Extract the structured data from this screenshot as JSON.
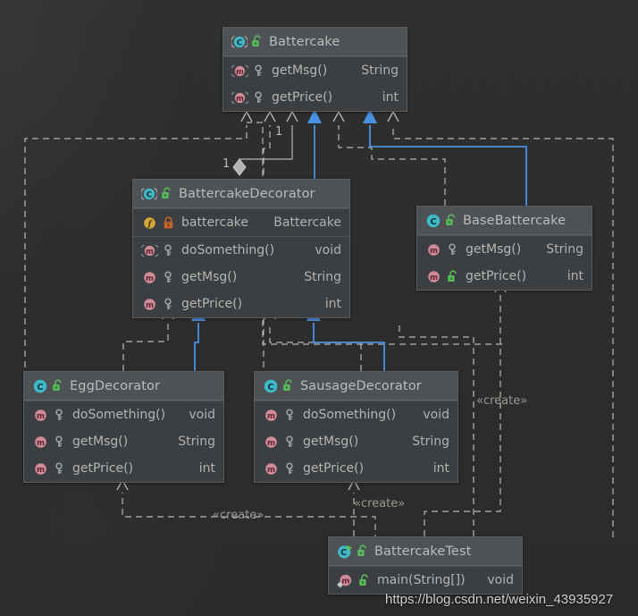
{
  "diagram": {
    "title": "Battercake decorator UML class diagram",
    "background_color": "#2e2e2e",
    "box_fill": "#3c3f41",
    "header_fill": "#4e5254",
    "inherit_arrow_color": "#4a90e2",
    "dashed_line_color": "#b0b0b0"
  },
  "classes": {
    "battercake": {
      "name": "Battercake",
      "class_icon": "interface-icon",
      "visibility_icon": "public-unlock-icon",
      "members": [
        {
          "label": "getMsg()",
          "type": "String",
          "member_icon": "abstract-method-icon",
          "visibility_icon": "key-icon"
        },
        {
          "label": "getPrice()",
          "type": "int",
          "member_icon": "abstract-method-icon",
          "visibility_icon": "key-icon"
        }
      ]
    },
    "battercake_decorator": {
      "name": "BattercakeDecorator",
      "class_icon": "abstract-class-icon",
      "visibility_icon": "public-unlock-icon",
      "fields": [
        {
          "label": "battercake",
          "type": "Battercake",
          "member_icon": "field-icon",
          "visibility_icon": "private-lock-icon"
        }
      ],
      "members": [
        {
          "label": "doSomething()",
          "type": "void",
          "member_icon": "abstract-method-icon",
          "visibility_icon": "key-icon"
        },
        {
          "label": "getMsg()",
          "type": "String",
          "member_icon": "method-icon",
          "visibility_icon": "key-icon"
        },
        {
          "label": "getPrice()",
          "type": "int",
          "member_icon": "method-icon",
          "visibility_icon": "key-icon"
        }
      ]
    },
    "base_battercake": {
      "name": "BaseBattercake",
      "class_icon": "class-icon",
      "visibility_icon": "public-unlock-icon",
      "members": [
        {
          "label": "getMsg()",
          "type": "String",
          "member_icon": "method-icon",
          "visibility_icon": "key-icon"
        },
        {
          "label": "getPrice()",
          "type": "int",
          "member_icon": "method-icon",
          "visibility_icon": "public-unlock-icon"
        }
      ]
    },
    "egg_decorator": {
      "name": "EggDecorator",
      "class_icon": "class-icon",
      "visibility_icon": "public-unlock-icon",
      "members": [
        {
          "label": "doSomething()",
          "type": "void",
          "member_icon": "method-icon",
          "visibility_icon": "key-icon"
        },
        {
          "label": "getMsg()",
          "type": "String",
          "member_icon": "method-icon",
          "visibility_icon": "key-icon"
        },
        {
          "label": "getPrice()",
          "type": "int",
          "member_icon": "method-icon",
          "visibility_icon": "key-icon"
        }
      ]
    },
    "sausage_decorator": {
      "name": "SausageDecorator",
      "class_icon": "class-icon",
      "visibility_icon": "public-unlock-icon",
      "members": [
        {
          "label": "doSomething()",
          "type": "void",
          "member_icon": "method-icon",
          "visibility_icon": "key-icon"
        },
        {
          "label": "getMsg()",
          "type": "String",
          "member_icon": "method-icon",
          "visibility_icon": "key-icon"
        },
        {
          "label": "getPrice()",
          "type": "int",
          "member_icon": "method-icon",
          "visibility_icon": "key-icon"
        }
      ]
    },
    "battercake_test": {
      "name": "BattercakeTest",
      "class_icon": "runnable-class-icon",
      "visibility_icon": "public-unlock-icon",
      "members": [
        {
          "label": "main(String[])",
          "type": "void",
          "member_icon": "main-method-icon",
          "visibility_icon": "public-unlock-icon"
        }
      ]
    }
  },
  "edge_labels": {
    "create_base": "«create»",
    "create_egg": "«create»",
    "create_sausage": "«create»",
    "mult_top": "1",
    "mult_diamond": "1"
  },
  "watermark": {
    "text": "https://blog.csdn.net/weixin_43935927"
  }
}
